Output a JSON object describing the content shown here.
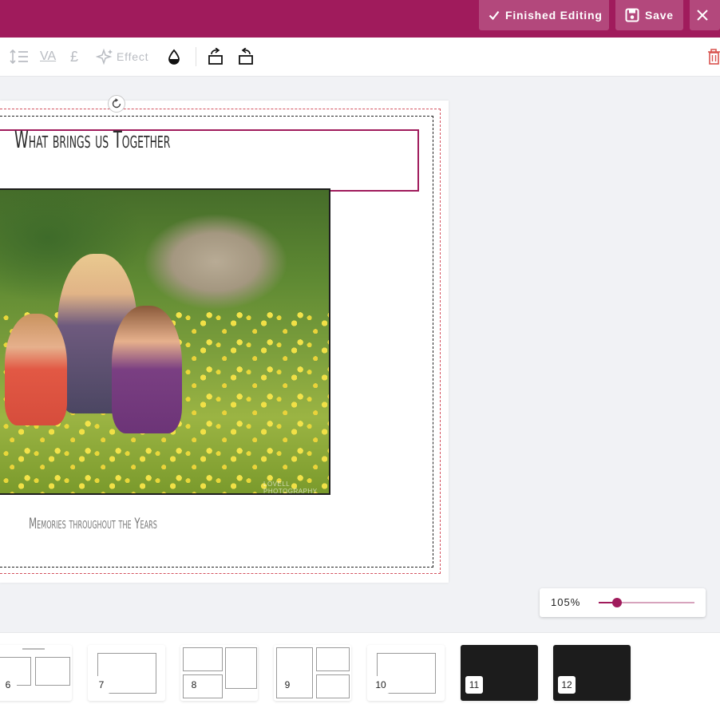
{
  "header": {
    "finished_label": "Finished Editing",
    "save_label": "Save"
  },
  "toolbar": {
    "effect_label": "Effect",
    "currency_symbol": "£",
    "tracking_label": "VA"
  },
  "canvas": {
    "title": "What brings us Together",
    "caption": "Memories throughout the Years",
    "photo_credit": "LOVELL PHOTOGRAPHY"
  },
  "zoom": {
    "label": "105%",
    "fraction": 0.19
  },
  "pages": [
    {
      "number": "6",
      "dark": false
    },
    {
      "number": "7",
      "dark": false
    },
    {
      "number": "8",
      "dark": false
    },
    {
      "number": "9",
      "dark": false
    },
    {
      "number": "10",
      "dark": false
    },
    {
      "number": "11",
      "dark": true
    },
    {
      "number": "12",
      "dark": true
    }
  ],
  "colors": {
    "brand": "#a01b5c",
    "delete": "#d9534f"
  }
}
